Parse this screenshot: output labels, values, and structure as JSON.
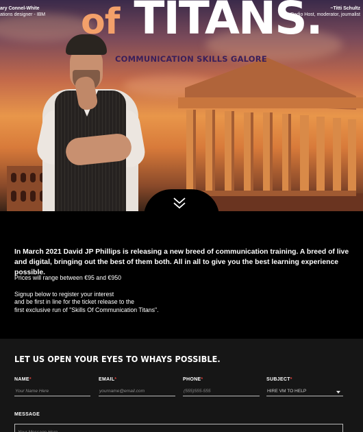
{
  "hero": {
    "title_prefix": "of",
    "title_main": "TITANS.",
    "subtitle": "COMMUNICATION SKILLS GALORE",
    "quote_left_name": "ary Connel-White",
    "quote_left_role": "ations designer - IBM",
    "quote_right_name": "~Titti Schultz",
    "quote_right_role": "Radio Host, moderator, journalist",
    "scroll_icon": "double-chevron-down-icon"
  },
  "info": {
    "lead": "In March 2021 David JP Phillips is releasing a new breed of communication training. A breed of live and digital, bringing out the best of them both. All in all to give you the best learning experience possible.",
    "price": "Prices will range between €95 and €950",
    "signup_lines": [
      "Signup below to register your interest",
      "and be first in line for the ticket release to the",
      "first exclusive run of \"Skills Of Communication Titans\"."
    ]
  },
  "form": {
    "heading": "LET US OPEN YOUR EYES TO WHAYS POSSIBLE.",
    "required_mark": "*",
    "name": {
      "label": "NAME",
      "placeholder": "Your Name Here"
    },
    "email": {
      "label": "EMAIL",
      "placeholder": "yourname@email.com"
    },
    "phone": {
      "label": "PHONE",
      "placeholder": "(555)555-555"
    },
    "subject": {
      "label": "SUBJECT",
      "value": "HIRE VM TO HELP"
    },
    "message": {
      "label": "MESSAGE",
      "placeholder": "Your Message Here"
    }
  },
  "colors": {
    "required": "#e0403a",
    "subtitle": "#3a1f5a",
    "accent_of": "#f3a06a"
  }
}
